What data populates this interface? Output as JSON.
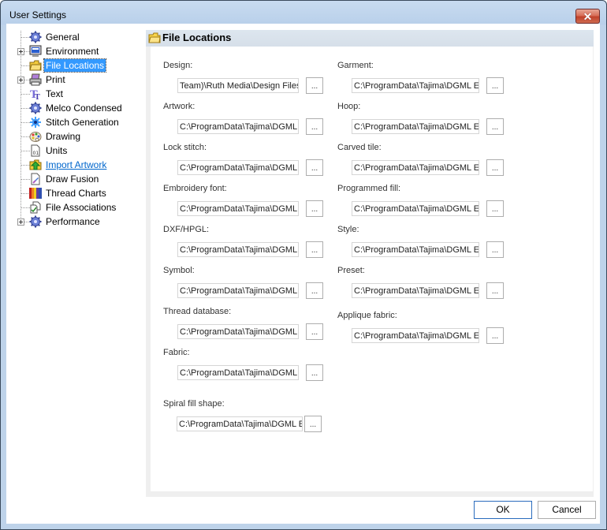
{
  "window": {
    "title": "User Settings",
    "close_glyph": "✕"
  },
  "tree": {
    "items": [
      {
        "label": "General",
        "icon": "gear-icon",
        "expandable": false
      },
      {
        "label": "Environment",
        "icon": "monitor-icon",
        "expandable": true
      },
      {
        "label": "File Locations",
        "icon": "folder-icon",
        "expandable": false,
        "selected": true
      },
      {
        "label": "Print",
        "icon": "printer-icon",
        "expandable": true
      },
      {
        "label": "Text",
        "icon": "text-icon",
        "expandable": false
      },
      {
        "label": "Melco Condensed",
        "icon": "gear-icon",
        "expandable": false
      },
      {
        "label": "Stitch Generation",
        "icon": "stitch-icon",
        "expandable": false
      },
      {
        "label": "Drawing",
        "icon": "palette-icon",
        "expandable": false
      },
      {
        "label": "Units",
        "icon": "units-icon",
        "expandable": false
      },
      {
        "label": "Import Artwork",
        "icon": "import-folder-icon",
        "expandable": false,
        "link": true
      },
      {
        "label": "Draw Fusion",
        "icon": "draw-fusion-icon",
        "expandable": false
      },
      {
        "label": "Thread Charts",
        "icon": "thread-chart-icon",
        "expandable": false
      },
      {
        "label": "File Associations",
        "icon": "file-association-icon",
        "expandable": false
      },
      {
        "label": "Performance",
        "icon": "gear-icon",
        "expandable": true
      }
    ]
  },
  "panel": {
    "title": "File Locations",
    "browse_label": "...",
    "left_fields": [
      {
        "label": "Design:",
        "value": "Team)\\Ruth Media\\Design Files"
      },
      {
        "label": "Artwork:",
        "value": "C:\\ProgramData\\Tajima\\DGML"
      },
      {
        "label": "Lock stitch:",
        "value": "C:\\ProgramData\\Tajima\\DGML"
      },
      {
        "label": "Embroidery font:",
        "value": "C:\\ProgramData\\Tajima\\DGML"
      },
      {
        "label": "DXF/HPGL:",
        "value": "C:\\ProgramData\\Tajima\\DGML"
      },
      {
        "label": "Symbol:",
        "value": "C:\\ProgramData\\Tajima\\DGML"
      },
      {
        "label": "Thread database:",
        "value": "C:\\ProgramData\\Tajima\\DGML"
      },
      {
        "label": "Fabric:",
        "value": "C:\\ProgramData\\Tajima\\DGML"
      },
      {
        "label": "Spiral fill shape:",
        "value": "C:\\ProgramData\\Tajima\\DGML E"
      }
    ],
    "right_fields": [
      {
        "label": "Garment:",
        "value": "C:\\ProgramData\\Tajima\\DGML E"
      },
      {
        "label": "Hoop:",
        "value": "C:\\ProgramData\\Tajima\\DGML E"
      },
      {
        "label": "Carved tile:",
        "value": "C:\\ProgramData\\Tajima\\DGML E"
      },
      {
        "label": "Programmed fill:",
        "value": "C:\\ProgramData\\Tajima\\DGML E"
      },
      {
        "label": "Style:",
        "value": "C:\\ProgramData\\Tajima\\DGML E"
      },
      {
        "label": "Preset:",
        "value": "C:\\ProgramData\\Tajima\\DGML E"
      },
      {
        "label": "Applique fabric:",
        "value": "C:\\ProgramData\\Tajima\\DGML E"
      }
    ]
  },
  "buttons": {
    "ok": "OK",
    "cancel": "Cancel"
  }
}
